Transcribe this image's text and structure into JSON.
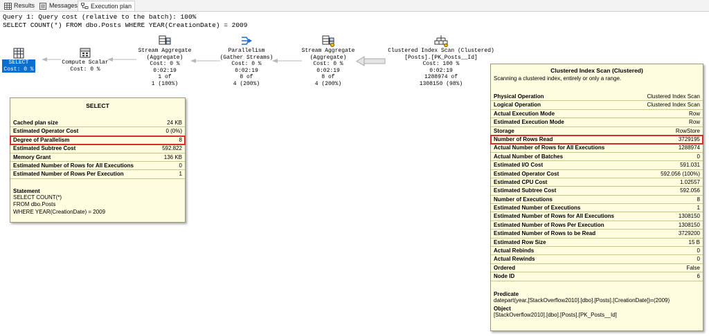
{
  "tabs": [
    {
      "label": "Results",
      "icon": "grid-icon"
    },
    {
      "label": "Messages",
      "icon": "messages-icon"
    },
    {
      "label": "Execution plan",
      "icon": "plan-icon"
    }
  ],
  "query": {
    "header": "Query 1: Query cost (relative to the batch): 100%",
    "text": "SELECT COUNT(*) FROM dbo.Posts WHERE YEAR(CreationDate) = 2009"
  },
  "plan": {
    "select": {
      "label": "SELECT",
      "cost": "Cost: 0 %"
    },
    "compute": {
      "lines": [
        "Compute Scalar",
        "Cost: 0 %"
      ]
    },
    "stream1": {
      "lines": [
        "Stream Aggregate",
        "(Aggregate)",
        "Cost: 0 %",
        "0:02:19",
        "1 of",
        "1 (100%)"
      ]
    },
    "parallel": {
      "lines": [
        "Parallelism",
        "(Gather Streams)",
        "Cost: 0 %",
        "0:02:19",
        "8 of",
        "4 (200%)"
      ]
    },
    "stream2": {
      "lines": [
        "Stream Aggregate",
        "(Aggregate)",
        "Cost: 0 %",
        "0:02:19",
        "8 of",
        "4 (200%)"
      ]
    },
    "scan": {
      "lines": [
        "Clustered Index Scan (Clustered)",
        "[Posts].[PK_Posts__Id]",
        "Cost: 100 %",
        "0:02:19",
        "1288974 of",
        "1308150 (98%)"
      ]
    }
  },
  "select_tip": {
    "title": "SELECT",
    "rows": [
      {
        "k": "Cached plan size",
        "v": "24 KB"
      },
      {
        "k": "Estimated Operator Cost",
        "v": "0 (0%)"
      },
      {
        "k": "Degree of Parallelism",
        "v": "8"
      },
      {
        "k": "Estimated Subtree Cost",
        "v": "592.822"
      },
      {
        "k": "Memory Grant",
        "v": "136 KB"
      },
      {
        "k": "Estimated Number of Rows for All Executions",
        "v": "0"
      },
      {
        "k": "Estimated Number of Rows Per Execution",
        "v": "1"
      }
    ],
    "statement_header": "Statement",
    "statement_lines": [
      "SELECT COUNT(*)",
      "FROM dbo.Posts",
      "WHERE YEAR(CreationDate) = 2009"
    ]
  },
  "scan_tip": {
    "title": "Clustered Index Scan (Clustered)",
    "subtitle": "Scanning a clustered index, entirely or only a range.",
    "rows": [
      {
        "k": "Physical Operation",
        "v": "Clustered Index Scan"
      },
      {
        "k": "Logical Operation",
        "v": "Clustered Index Scan"
      },
      {
        "k": "Actual Execution Mode",
        "v": "Row"
      },
      {
        "k": "Estimated Execution Mode",
        "v": "Row"
      },
      {
        "k": "Storage",
        "v": "RowStore"
      },
      {
        "k": "Number of Rows Read",
        "v": "3729195"
      },
      {
        "k": "Actual Number of Rows for All Executions",
        "v": "1288974"
      },
      {
        "k": "Actual Number of Batches",
        "v": "0"
      },
      {
        "k": "Estimated I/O Cost",
        "v": "591.031"
      },
      {
        "k": "Estimated Operator Cost",
        "v": "592.056 (100%)"
      },
      {
        "k": "Estimated CPU Cost",
        "v": "1.02557"
      },
      {
        "k": "Estimated Subtree Cost",
        "v": "592.056"
      },
      {
        "k": "Number of Executions",
        "v": "8"
      },
      {
        "k": "Estimated Number of Executions",
        "v": "1"
      },
      {
        "k": "Estimated Number of Rows for All Executions",
        "v": "1308150"
      },
      {
        "k": "Estimated Number of Rows Per Execution",
        "v": "1308150"
      },
      {
        "k": "Estimated Number of Rows to be Read",
        "v": "3729200"
      },
      {
        "k": "Estimated Row Size",
        "v": "15 B"
      },
      {
        "k": "Actual Rebinds",
        "v": "0"
      },
      {
        "k": "Actual Rewinds",
        "v": "0"
      },
      {
        "k": "Ordered",
        "v": "False"
      },
      {
        "k": "Node ID",
        "v": "6"
      }
    ],
    "predicate_header": "Predicate",
    "predicate": "datepart(year,[StackOverflow2010].[dbo].[Posts].[CreationDate])=(2009)",
    "object_header": "Object",
    "object": "[StackOverflow2010].[dbo].[Posts].[PK_Posts__Id]"
  },
  "colors": {
    "highlight": "#d92b2b",
    "tooltip_bg": "#fefde0",
    "selected": "#0b6fce"
  }
}
